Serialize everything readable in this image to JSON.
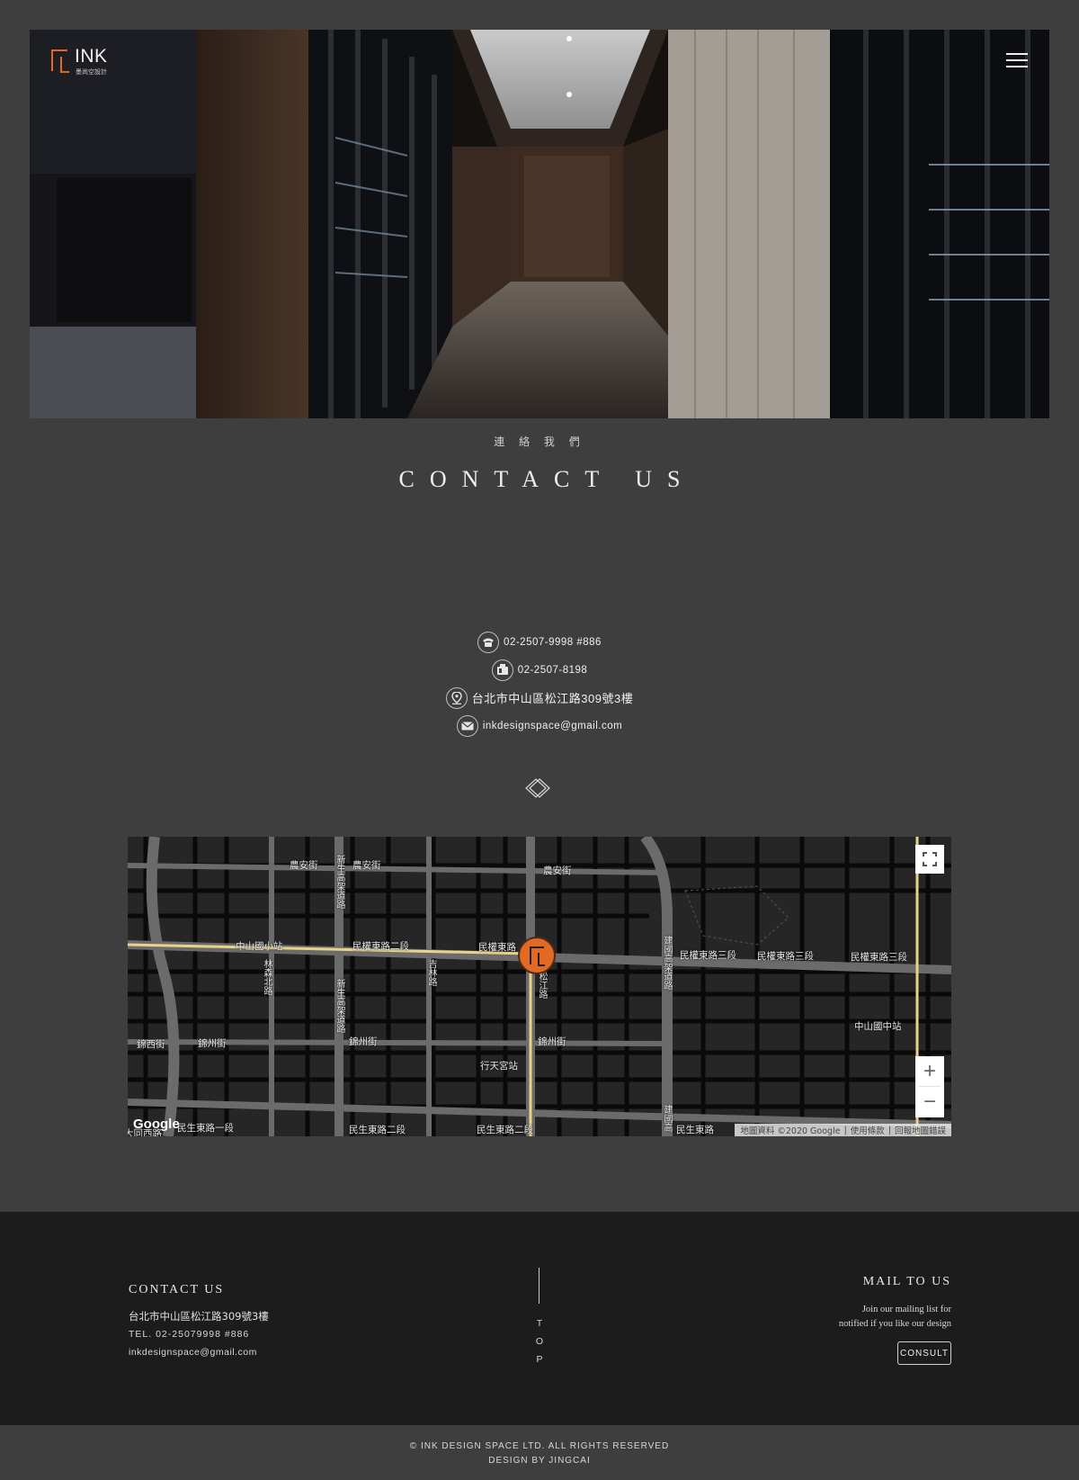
{
  "header": {
    "logo_text": "INK",
    "logo_sub": "墨尚空設計",
    "menu_icon": "hamburger-menu-icon"
  },
  "hero": {
    "image": "dark interior corridor with wood and glass walls"
  },
  "section": {
    "subtitle": "連 絡 我 們",
    "title": "CONTACT US"
  },
  "contact": {
    "phone": "02-2507-9998 #886",
    "fax": "02-2507-8198",
    "address": "台北市中山區松江路309號3樓",
    "email": "inkdesignspace@gmail.com",
    "icons": [
      "phone-icon",
      "fax-icon",
      "location-pin-icon",
      "mail-icon"
    ]
  },
  "map": {
    "labels": {
      "nongan1": "農安街",
      "nongan2": "農安街",
      "nongan3": "農安街",
      "xinsheng_n": "新生高架道路",
      "zhongshan_sta": "中山國小站",
      "linsen": "林森北路",
      "minquan2": "民權東路二段",
      "minquan_e": "民權東路",
      "jilin": "吉林路",
      "songjiang": "松江路",
      "jianguo": "建國高架道路",
      "minquan3a": "民權東路三段",
      "minquan3b": "民權東路三段",
      "minquan3c": "民權東路三段",
      "xinsheng_s": "新生高架道路",
      "jinzhou1": "錦州街",
      "jinzhou2": "錦州街",
      "jinzhou3": "錦州街",
      "jinxi": "錦西街",
      "xingtian": "行天宮站",
      "zhongshan_jh": "中山國中站",
      "minsheng1": "民生東路一段",
      "minsheng2a": "民生東路二段",
      "minsheng2b": "民生東路二段",
      "minsheng_e": "民生東路",
      "jianguo_s": "建國高",
      "jiaotong": "大同西路"
    },
    "google": "Google",
    "attribution": "地圖資料 ©2020 Google",
    "terms": "使用條款",
    "report": "回報地圖錯誤",
    "zoom_in": "+",
    "zoom_out": "−"
  },
  "footer": {
    "contact_title": "CONTACT US",
    "address": "台北市中山區松江路309號3樓",
    "tel": "TEL. 02-25079998 #886",
    "email": "inkdesignspace@gmail.com",
    "top_t": "T",
    "top_o": "O",
    "top_p": "P",
    "mail_title": "MAIL TO US",
    "mail_desc1": "Join our mailing list for",
    "mail_desc2": "notified if you like our design",
    "consult": "CONSULT"
  },
  "copyright": {
    "line1": "© INK DESIGN SPACE LTD. ALL RIGHTS RESERVED",
    "line2": "DESIGN BY JINGCAI"
  },
  "colors": {
    "accent": "#e26a24",
    "page_bg": "#3e3e3e",
    "footer_bg": "#1c1c1c"
  }
}
